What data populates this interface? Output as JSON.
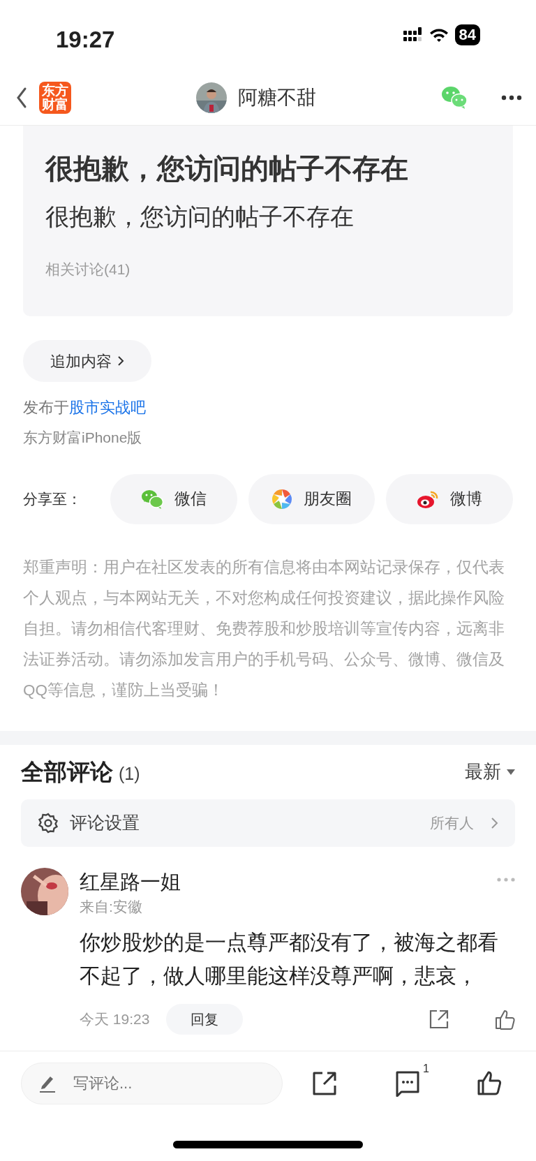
{
  "status_bar": {
    "time": "19:27",
    "battery": "84"
  },
  "header": {
    "logo_text": "东方财富",
    "username": "阿糖不甜"
  },
  "post": {
    "title": "很抱歉，您访问的帖子不存在",
    "body": "很抱歉，您访问的帖子不存在",
    "related": "相关讨论(41)"
  },
  "add_content": "追加内容",
  "published": {
    "prefix": "发布于",
    "forum": "股市实战吧",
    "source": "东方财富iPhone版"
  },
  "share": {
    "label": "分享至：",
    "targets": [
      {
        "kind": "wechat",
        "label": "微信"
      },
      {
        "kind": "moments",
        "label": "朋友圈"
      },
      {
        "kind": "weibo",
        "label": "微博"
      }
    ]
  },
  "disclaimer": "郑重声明：用户在社区发表的所有信息将由本网站记录保存，仅代表个人观点，与本网站无关，不对您构成任何投资建议，据此操作风险自担。请勿相信代客理财、免费荐股和炒股培训等宣传内容，远离非法证券活动。请勿添加发言用户的手机号码、公众号、微博、微信及QQ等信息，谨防上当受骗！",
  "comments": {
    "title": "全部评论",
    "count": "(1)",
    "sort": "最新",
    "settings": {
      "label": "评论设置",
      "value": "所有人"
    },
    "items": [
      {
        "author": "红星路一姐",
        "location": "来自:安徽",
        "text": "你炒股炒的是一点尊严都没有了，被海之都看不起了，做人哪里能这样没尊严啊，悲哀，",
        "time": "今天 19:23",
        "reply": "回复"
      }
    ]
  },
  "bottom_bar": {
    "placeholder": "写评论...",
    "comment_count": "1"
  }
}
